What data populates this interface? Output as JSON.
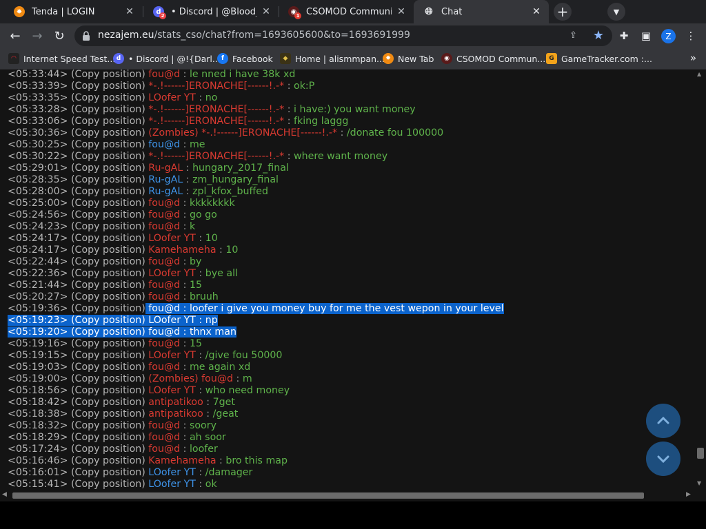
{
  "browser": {
    "tabs": [
      {
        "title": "Tenda | LOGIN",
        "active": false
      },
      {
        "title": "• Discord | @Blood_Band",
        "active": false,
        "badge": "2"
      },
      {
        "title": "CSOMOD Community",
        "active": false,
        "badge": "1"
      },
      {
        "title": "Chat",
        "active": true
      }
    ],
    "url_host": "nezajem.eu",
    "url_path": "/stats_cso/chat?from=1693605600&to=1693691999",
    "profile_initial": "Z",
    "bookmarks": [
      {
        "label": "Internet Speed Test..."
      },
      {
        "label": "• Discord | @!{Darl...",
        "badge": "2"
      },
      {
        "label": "Facebook"
      },
      {
        "label": "Home | alismmpan..."
      },
      {
        "label": "New Tab"
      },
      {
        "label": "CSOMOD Commun...",
        "badge": "1"
      },
      {
        "label": "GameTracker.com :..."
      }
    ]
  },
  "chat": {
    "copy_label": "(Copy position)",
    "separator": " : ",
    "rows": [
      {
        "time": "<05:33:44>",
        "prefix": "",
        "name": "fou@d",
        "color": "red",
        "msg": "le nned i have 38k xd"
      },
      {
        "time": "<05:33:39>",
        "prefix": "",
        "name": "*-.!------]ERONACHE[------!.-*",
        "color": "red",
        "msg": "ok:P"
      },
      {
        "time": "<05:33:35>",
        "prefix": "",
        "name": "LOofer YT",
        "color": "red",
        "msg": "no"
      },
      {
        "time": "<05:33:28>",
        "prefix": "",
        "name": "*-.!------]ERONACHE[------!.-*",
        "color": "red",
        "msg": "i have:) you want money"
      },
      {
        "time": "<05:33:06>",
        "prefix": "",
        "name": "*-.!------]ERONACHE[------!.-*",
        "color": "red",
        "msg": "fking laggg"
      },
      {
        "time": "<05:30:36>",
        "prefix": "(Zombies) ",
        "name": "*-.!------]ERONACHE[------!.-*",
        "color": "red",
        "msg": "/donate fou 100000"
      },
      {
        "time": "<05:30:25>",
        "prefix": "",
        "name": "fou@d",
        "color": "blue",
        "msg": "me"
      },
      {
        "time": "<05:30:22>",
        "prefix": "",
        "name": "*-.!------]ERONACHE[------!.-*",
        "color": "red",
        "msg": "where want money"
      },
      {
        "time": "<05:29:01>",
        "prefix": "",
        "name": "Ru-gAL",
        "color": "red",
        "msg": "hungary_2017_final"
      },
      {
        "time": "<05:28:35>",
        "prefix": "",
        "name": "Ru-gAL",
        "color": "blue",
        "msg": "zm_hungary_final"
      },
      {
        "time": "<05:28:00>",
        "prefix": "",
        "name": "Ru-gAL",
        "color": "blue",
        "msg": "zpl_kfox_buffed"
      },
      {
        "time": "<05:25:00>",
        "prefix": "",
        "name": "fou@d",
        "color": "red",
        "msg": "kkkkkkkk"
      },
      {
        "time": "<05:24:56>",
        "prefix": "",
        "name": "fou@d",
        "color": "red",
        "msg": "go go"
      },
      {
        "time": "<05:24:23>",
        "prefix": "",
        "name": "fou@d",
        "color": "red",
        "msg": "k"
      },
      {
        "time": "<05:24:17>",
        "prefix": "",
        "name": "LOofer YT",
        "color": "red",
        "msg": "10"
      },
      {
        "time": "<05:24:17>",
        "prefix": "",
        "name": "Kamehameha",
        "color": "red",
        "msg": "10"
      },
      {
        "time": "<05:22:44>",
        "prefix": "",
        "name": "fou@d",
        "color": "red",
        "msg": "by"
      },
      {
        "time": "<05:22:36>",
        "prefix": "",
        "name": "LOofer YT",
        "color": "red",
        "msg": "bye all"
      },
      {
        "time": "<05:21:44>",
        "prefix": "",
        "name": "fou@d",
        "color": "red",
        "msg": "15"
      },
      {
        "time": "<05:20:27>",
        "prefix": "",
        "name": "fou@d",
        "color": "red",
        "msg": "bruuh"
      },
      {
        "time": "<05:19:36>",
        "prefix": "",
        "name": "fou@d",
        "color": "red",
        "msg": "loofer i give you money buy for me the vest wepon in your level",
        "selected": "tail"
      },
      {
        "time": "<05:19:23>",
        "prefix": "",
        "name": "LOofer YT",
        "color": "red",
        "msg": "np",
        "selected": "full"
      },
      {
        "time": "<05:19:20>",
        "prefix": "",
        "name": "fou@d",
        "color": "red",
        "msg": "thnx man",
        "selected": "full"
      },
      {
        "time": "<05:19:16>",
        "prefix": "",
        "name": "fou@d",
        "color": "red",
        "msg": "15"
      },
      {
        "time": "<05:19:15>",
        "prefix": "",
        "name": "LOofer YT",
        "color": "red",
        "msg": "/give fou 50000"
      },
      {
        "time": "<05:19:03>",
        "prefix": "",
        "name": "fou@d",
        "color": "red",
        "msg": "me again xd"
      },
      {
        "time": "<05:19:00>",
        "prefix": "(Zombies) ",
        "name": "fou@d",
        "color": "red",
        "msg": "m"
      },
      {
        "time": "<05:18:56>",
        "prefix": "",
        "name": "LOofer YT",
        "color": "red",
        "msg": "who need money"
      },
      {
        "time": "<05:18:42>",
        "prefix": "",
        "name": "antipatikoo",
        "color": "red",
        "msg": "7get"
      },
      {
        "time": "<05:18:38>",
        "prefix": "",
        "name": "antipatikoo",
        "color": "red",
        "msg": "/geat"
      },
      {
        "time": "<05:18:32>",
        "prefix": "",
        "name": "fou@d",
        "color": "red",
        "msg": "soory"
      },
      {
        "time": "<05:18:29>",
        "prefix": "",
        "name": "fou@d",
        "color": "red",
        "msg": "ah soor"
      },
      {
        "time": "<05:17:24>",
        "prefix": "",
        "name": "fou@d",
        "color": "red",
        "msg": "loofer"
      },
      {
        "time": "<05:16:46>",
        "prefix": "",
        "name": "Kamehameha",
        "color": "red",
        "msg": "bro this map"
      },
      {
        "time": "<05:16:01>",
        "prefix": "",
        "name": "LOofer YT",
        "color": "blue",
        "msg": "/damager"
      },
      {
        "time": "<05:15:41>",
        "prefix": "",
        "name": "LOofer YT",
        "color": "blue",
        "msg": "ok"
      }
    ]
  },
  "colors": {
    "name_red": "#d93a31",
    "name_blue": "#3e93e8",
    "message_green": "#5fb34b",
    "selection": "#0b63cc",
    "fab": "#1d4e7e"
  }
}
